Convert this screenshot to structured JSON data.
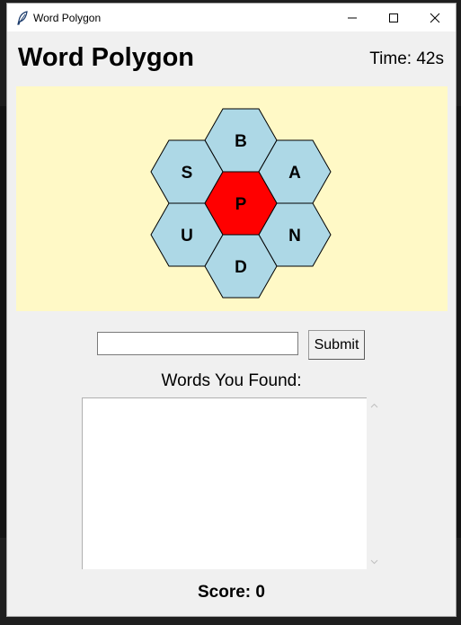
{
  "window": {
    "title": "Word Polygon",
    "icon": "feather-icon"
  },
  "header": {
    "title": "Word Polygon",
    "timer": "Time: 42s"
  },
  "board": {
    "background": "#fff9c6",
    "outer_color": "#add8e6",
    "center_color": "#ff0000",
    "center_letter": "P",
    "outer_letters": {
      "top": "B",
      "upper_left": "S",
      "upper_right": "A",
      "lower_left": "U",
      "lower_right": "N",
      "bottom": "D"
    }
  },
  "entry": {
    "value": "",
    "placeholder": "",
    "submit_label": "Submit"
  },
  "found": {
    "label": "Words You Found:",
    "words": []
  },
  "score": {
    "text": "Score: 0"
  }
}
